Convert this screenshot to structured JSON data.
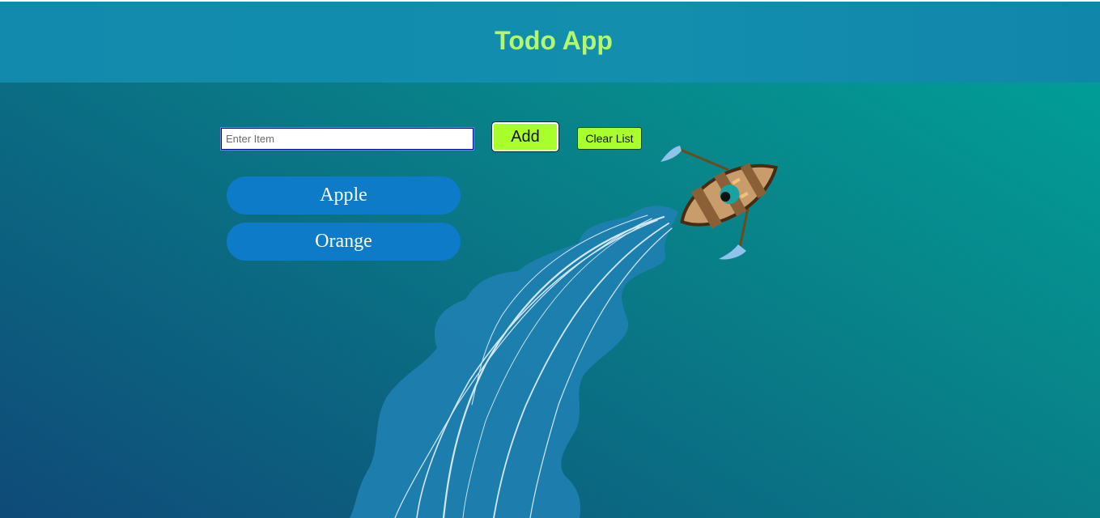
{
  "header": {
    "title": "Todo App",
    "title_color": "#b3f76f"
  },
  "form": {
    "input_placeholder": "Enter Item",
    "input_value": "",
    "add_label": "Add",
    "clear_label": "Clear List",
    "button_color": "#a8ff2c"
  },
  "todos": [
    {
      "label": "Apple"
    },
    {
      "label": "Orange"
    }
  ],
  "colors": {
    "header_bg": "#128aad",
    "item_bg": "#0d7bc8",
    "wake": "#1f7fb0"
  },
  "icons": {
    "illustration": "rowboat-illustration"
  }
}
